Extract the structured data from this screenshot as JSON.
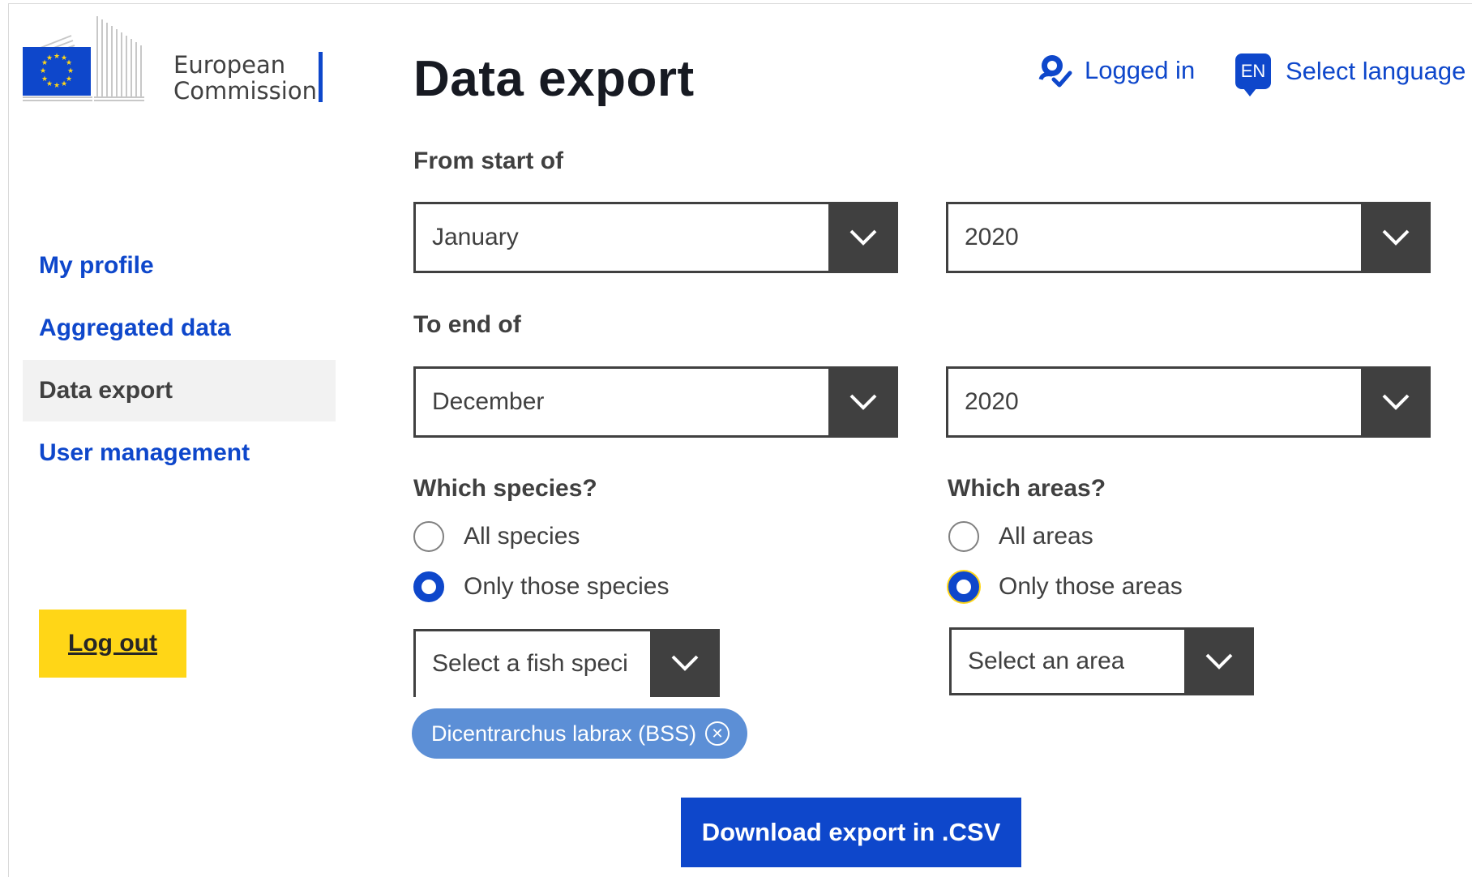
{
  "brand": {
    "name_line1": "European",
    "name_line2": "Commission",
    "flag_color": "#0e47cb",
    "star_color": "#ffd617"
  },
  "header": {
    "title": "Data export",
    "logged_in_label": "Logged in",
    "language_code": "EN",
    "select_language_label": "Select language"
  },
  "sidebar": {
    "items": [
      {
        "label": "My profile",
        "active": false
      },
      {
        "label": "Aggregated data",
        "active": false
      },
      {
        "label": "Data export",
        "active": true
      },
      {
        "label": "User management",
        "active": false
      }
    ],
    "logout_label": "Log out"
  },
  "form": {
    "from_label": "From start of",
    "from_month": "January",
    "from_year": "2020",
    "to_label": "To end of",
    "to_month": "December",
    "to_year": "2020",
    "species": {
      "label": "Which species?",
      "options": [
        {
          "label": "All species",
          "checked": false
        },
        {
          "label": "Only those species",
          "checked": true
        }
      ],
      "select_placeholder": "Select a fish speci",
      "selected_chips": [
        "Dicentrarchus labrax (BSS)"
      ]
    },
    "areas": {
      "label": "Which areas?",
      "options": [
        {
          "label": "All areas",
          "checked": false
        },
        {
          "label": "Only those areas",
          "checked": true
        }
      ],
      "select_placeholder": "Select an area"
    },
    "download_label": "Download export in .CSV"
  },
  "colors": {
    "primary": "#0e47cb",
    "accent_yellow": "#ffd617",
    "dark": "#404040",
    "chip": "#5c8fd6"
  }
}
